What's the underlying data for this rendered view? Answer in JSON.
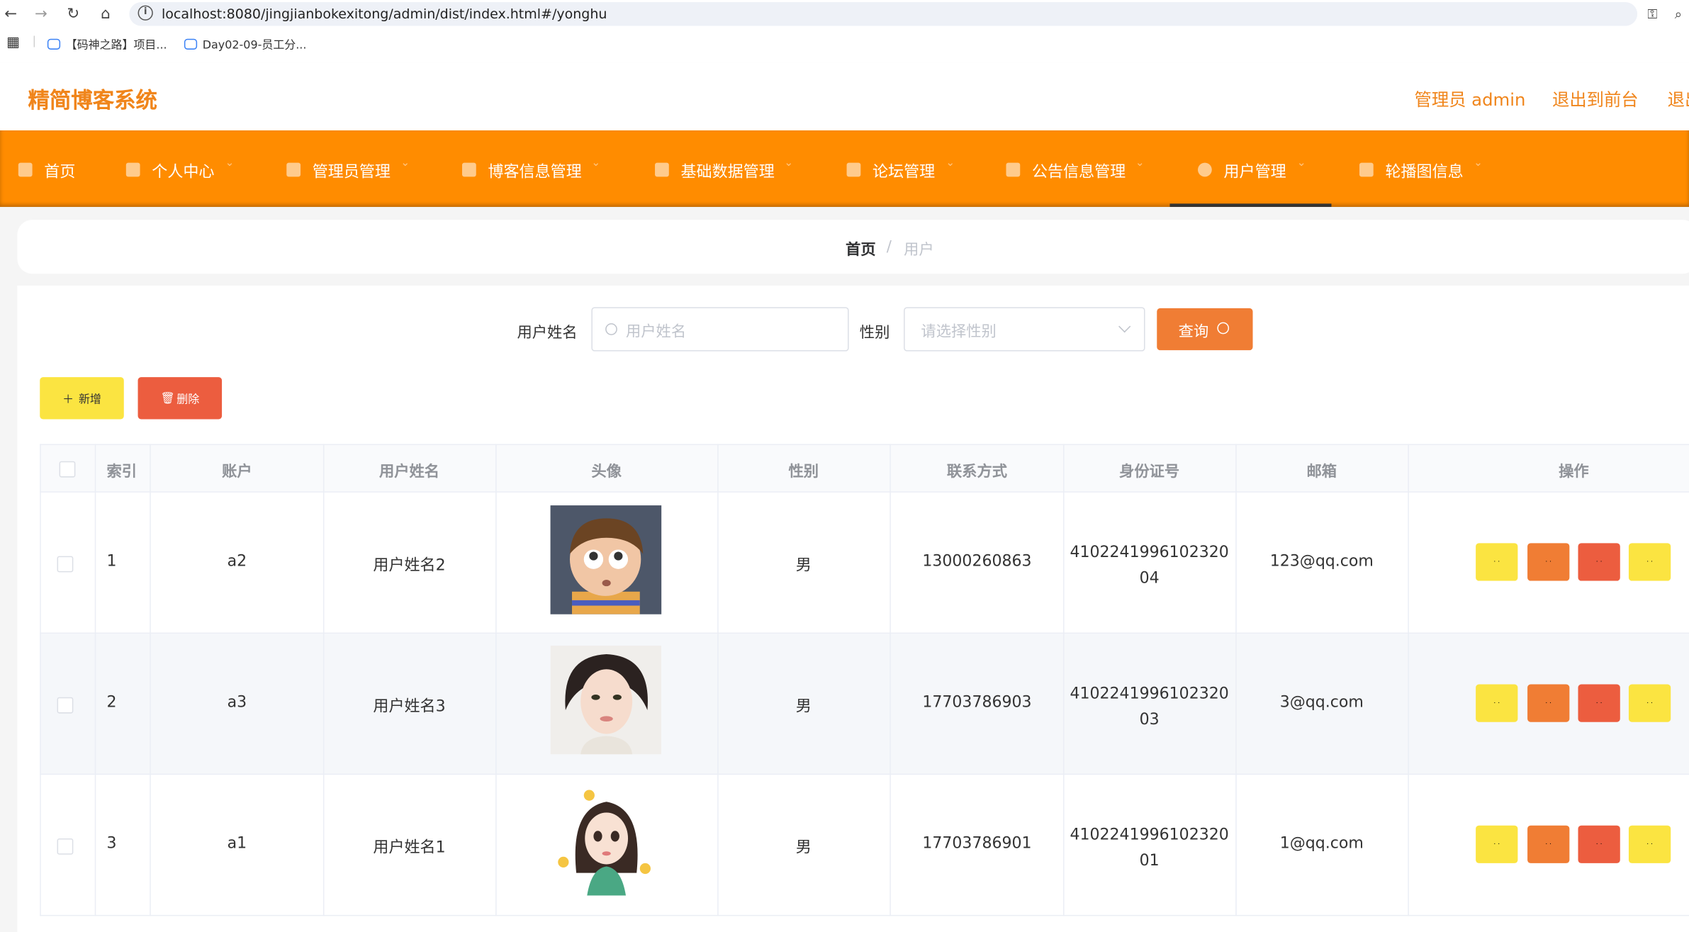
{
  "browser": {
    "url": "localhost:8080/jingjianbokexitong/admin/dist/index.html#/yonghu",
    "bookmarks": [
      "【码神之路】项目...",
      "Day02-09-员工分..."
    ]
  },
  "header": {
    "brand": "精简博客系统",
    "user": "管理员 admin",
    "front": "退出到前台",
    "logout": "退出登录"
  },
  "nav": {
    "items": [
      {
        "label": "首页"
      },
      {
        "label": "个人中心"
      },
      {
        "label": "管理员管理"
      },
      {
        "label": "博客信息管理"
      },
      {
        "label": "基础数据管理"
      },
      {
        "label": "论坛管理"
      },
      {
        "label": "公告信息管理"
      },
      {
        "label": "用户管理"
      },
      {
        "label": "轮播图信息"
      }
    ],
    "active": "用户管理"
  },
  "breadcrumb": {
    "home": "首页",
    "sep": "/",
    "current": "用户"
  },
  "search": {
    "name_label": "用户姓名",
    "name_placeholder": "用户姓名",
    "gender_label": "性别",
    "gender_placeholder": "请选择性别",
    "query_button": "查询"
  },
  "actions": {
    "add": "新增",
    "delete": "删除"
  },
  "table": {
    "columns": [
      "索引",
      "账户",
      "用户姓名",
      "头像",
      "性别",
      "联系方式",
      "身份证号",
      "邮箱",
      "操作"
    ],
    "rows": [
      {
        "index": "1",
        "account": "a2",
        "name": "用户姓名2",
        "avatar": "cartoon-boy-avatar",
        "gender": "男",
        "phone": "13000260863",
        "id_card": "410224199610232004",
        "email": "123@qq.com"
      },
      {
        "index": "2",
        "account": "a3",
        "name": "用户姓名3",
        "avatar": "woman-portrait-avatar",
        "gender": "男",
        "phone": "17703786903",
        "id_card": "410224199610232003",
        "email": "3@qq.com"
      },
      {
        "index": "3",
        "account": "a1",
        "name": "用户姓名1",
        "avatar": "cartoon-girl-avatar",
        "gender": "男",
        "phone": "17703786901",
        "id_card": "410224199610232001",
        "email": "1@qq.com"
      }
    ],
    "op_colors": [
      "#fbe441",
      "#f07d34",
      "#ec5d3f",
      "#fbe441"
    ]
  },
  "colors": {
    "brand": "#f0851b",
    "nav": "#ff8c00",
    "query": "#f07d34",
    "add": "#fbe441",
    "delete": "#ec5d3f"
  }
}
